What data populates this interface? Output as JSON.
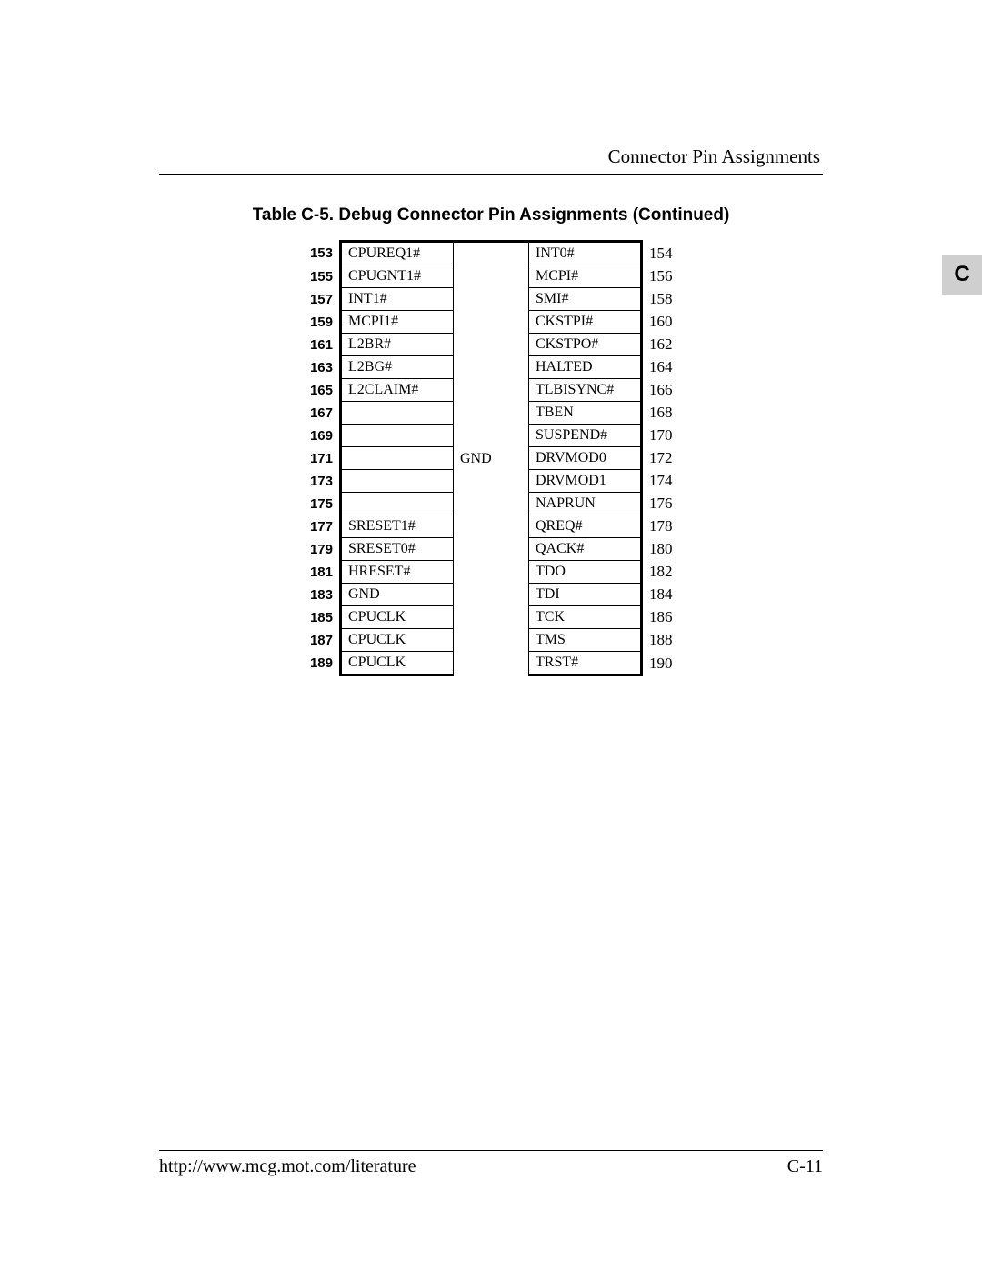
{
  "header": {
    "title": "Connector Pin Assignments"
  },
  "section_tab": "C",
  "table": {
    "title": "Table C-5.  Debug Connector Pin Assignments (Continued)",
    "center_label": "GND",
    "rows": [
      {
        "left_pin": "153",
        "left_sig": "CPUREQ1#",
        "right_sig": "INT0#",
        "right_pin": "154"
      },
      {
        "left_pin": "155",
        "left_sig": "CPUGNT1#",
        "right_sig": "MCPI#",
        "right_pin": "156"
      },
      {
        "left_pin": "157",
        "left_sig": "INT1#",
        "right_sig": "SMI#",
        "right_pin": "158"
      },
      {
        "left_pin": "159",
        "left_sig": "MCPI1#",
        "right_sig": "CKSTPI#",
        "right_pin": "160"
      },
      {
        "left_pin": "161",
        "left_sig": "L2BR#",
        "right_sig": "CKSTPO#",
        "right_pin": "162"
      },
      {
        "left_pin": "163",
        "left_sig": "L2BG#",
        "right_sig": "HALTED",
        "right_pin": "164"
      },
      {
        "left_pin": "165",
        "left_sig": "L2CLAIM#",
        "right_sig": "TLBISYNC#",
        "right_pin": "166"
      },
      {
        "left_pin": "167",
        "left_sig": "",
        "right_sig": "TBEN",
        "right_pin": "168"
      },
      {
        "left_pin": "169",
        "left_sig": "",
        "right_sig": "SUSPEND#",
        "right_pin": "170"
      },
      {
        "left_pin": "171",
        "left_sig": "",
        "right_sig": "DRVMOD0",
        "right_pin": "172"
      },
      {
        "left_pin": "173",
        "left_sig": "",
        "right_sig": "DRVMOD1",
        "right_pin": "174"
      },
      {
        "left_pin": "175",
        "left_sig": "",
        "right_sig": "NAPRUN",
        "right_pin": "176"
      },
      {
        "left_pin": "177",
        "left_sig": "SRESET1#",
        "right_sig": "QREQ#",
        "right_pin": "178"
      },
      {
        "left_pin": "179",
        "left_sig": "SRESET0#",
        "right_sig": "QACK#",
        "right_pin": "180"
      },
      {
        "left_pin": "181",
        "left_sig": "HRESET#",
        "right_sig": "TDO",
        "right_pin": "182"
      },
      {
        "left_pin": "183",
        "left_sig": "GND",
        "right_sig": "TDI",
        "right_pin": "184"
      },
      {
        "left_pin": "185",
        "left_sig": "CPUCLK",
        "right_sig": "TCK",
        "right_pin": "186"
      },
      {
        "left_pin": "187",
        "left_sig": "CPUCLK",
        "right_sig": "TMS",
        "right_pin": "188"
      },
      {
        "left_pin": "189",
        "left_sig": "CPUCLK",
        "right_sig": "TRST#",
        "right_pin": "190"
      }
    ]
  },
  "footer": {
    "url": "http://www.mcg.mot.com/literature",
    "page": "C-11"
  }
}
